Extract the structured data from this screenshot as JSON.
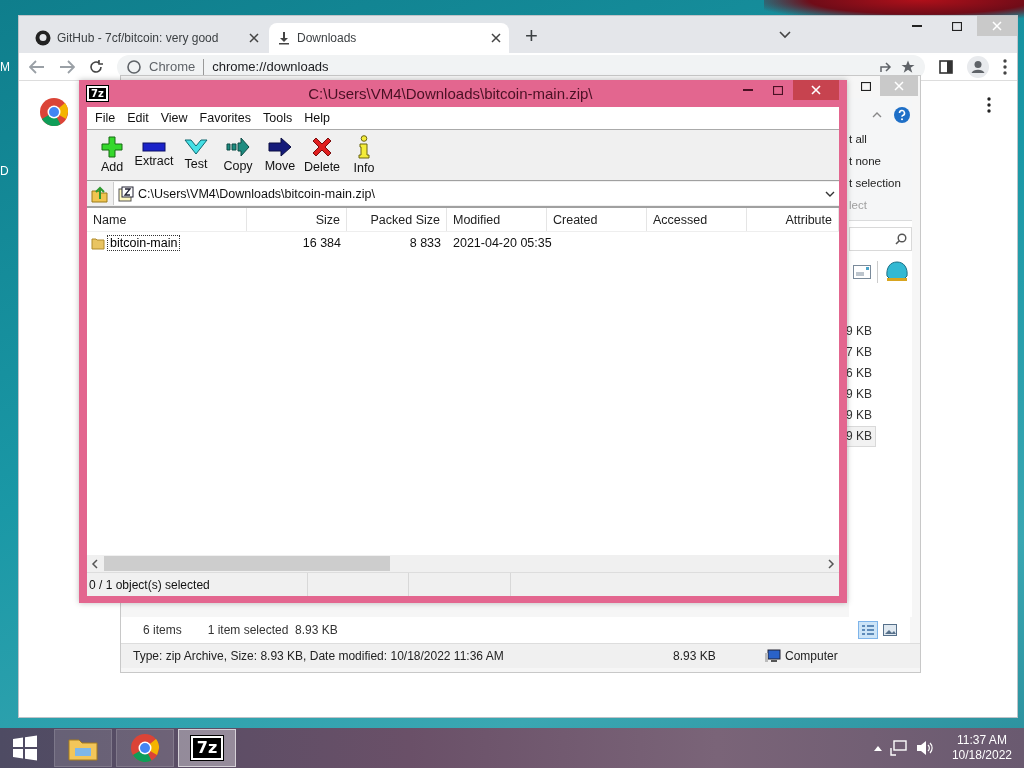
{
  "desktop": {
    "edge_labels": [
      "M",
      "D"
    ]
  },
  "browser": {
    "tabs": [
      {
        "title": "GitHub - 7cf/bitcoin: very good",
        "selected": false
      },
      {
        "title": "Downloads",
        "selected": true
      }
    ],
    "new_tab": "+",
    "address": {
      "site_label": "Chrome",
      "url": "chrome://downloads"
    }
  },
  "explorer": {
    "ribbon_items": [
      {
        "label": "t all",
        "disabled": false
      },
      {
        "label": "t none",
        "disabled": false
      },
      {
        "label": "t selection",
        "disabled": false
      },
      {
        "label": "lect",
        "disabled": true
      }
    ],
    "files": [
      {
        "size": "9 KB",
        "selected": false
      },
      {
        "size": "7 KB",
        "selected": false
      },
      {
        "size": "6 KB",
        "selected": false
      },
      {
        "size": "9 KB",
        "selected": false
      },
      {
        "size": "9 KB",
        "selected": false
      },
      {
        "size": "9 KB",
        "selected": true
      }
    ],
    "status": {
      "item_count": "6 items",
      "selection": "1 item selected  8.93 KB"
    },
    "views": [
      {
        "kind": "details",
        "selected": true
      },
      {
        "kind": "large",
        "selected": false
      }
    ],
    "details": {
      "summary": "Type: zip Archive, Size: 8.93 KB, Date modified: 10/18/2022 11:36 AM",
      "size": "8.93 KB",
      "location": "Computer"
    }
  },
  "archiver": {
    "logo_text": "7z",
    "title": "C:\\Users\\VM4\\Downloads\\bitcoin-main.zip\\",
    "menu": [
      "File",
      "Edit",
      "View",
      "Favorites",
      "Tools",
      "Help"
    ],
    "toolbar": [
      {
        "label": "Add",
        "kind": "add"
      },
      {
        "label": "Extract",
        "kind": "extract"
      },
      {
        "label": "Test",
        "kind": "test"
      },
      {
        "label": "Copy",
        "kind": "copy"
      },
      {
        "label": "Move",
        "kind": "move"
      },
      {
        "label": "Delete",
        "kind": "delete"
      },
      {
        "label": "Info",
        "kind": "info"
      }
    ],
    "path": "C:\\Users\\VM4\\Downloads\\bitcoin-main.zip\\",
    "columns": [
      "Name",
      "Size",
      "Packed Size",
      "Modified",
      "Created",
      "Accessed",
      "Attribute"
    ],
    "rows": [
      {
        "name": "bitcoin-main",
        "size": "16 384",
        "packed_size": "8 833",
        "modified": "2021-04-20 05:35",
        "focused": true
      }
    ],
    "status": "0 / 1 object(s) selected"
  },
  "taskbar": {
    "apps": [
      {
        "kind": "explorer",
        "active": false
      },
      {
        "kind": "chrome",
        "active": false
      },
      {
        "kind": "archiver",
        "active": true,
        "logo_text": "7z"
      }
    ],
    "time": "11:37 AM",
    "date": "10/18/2022"
  }
}
